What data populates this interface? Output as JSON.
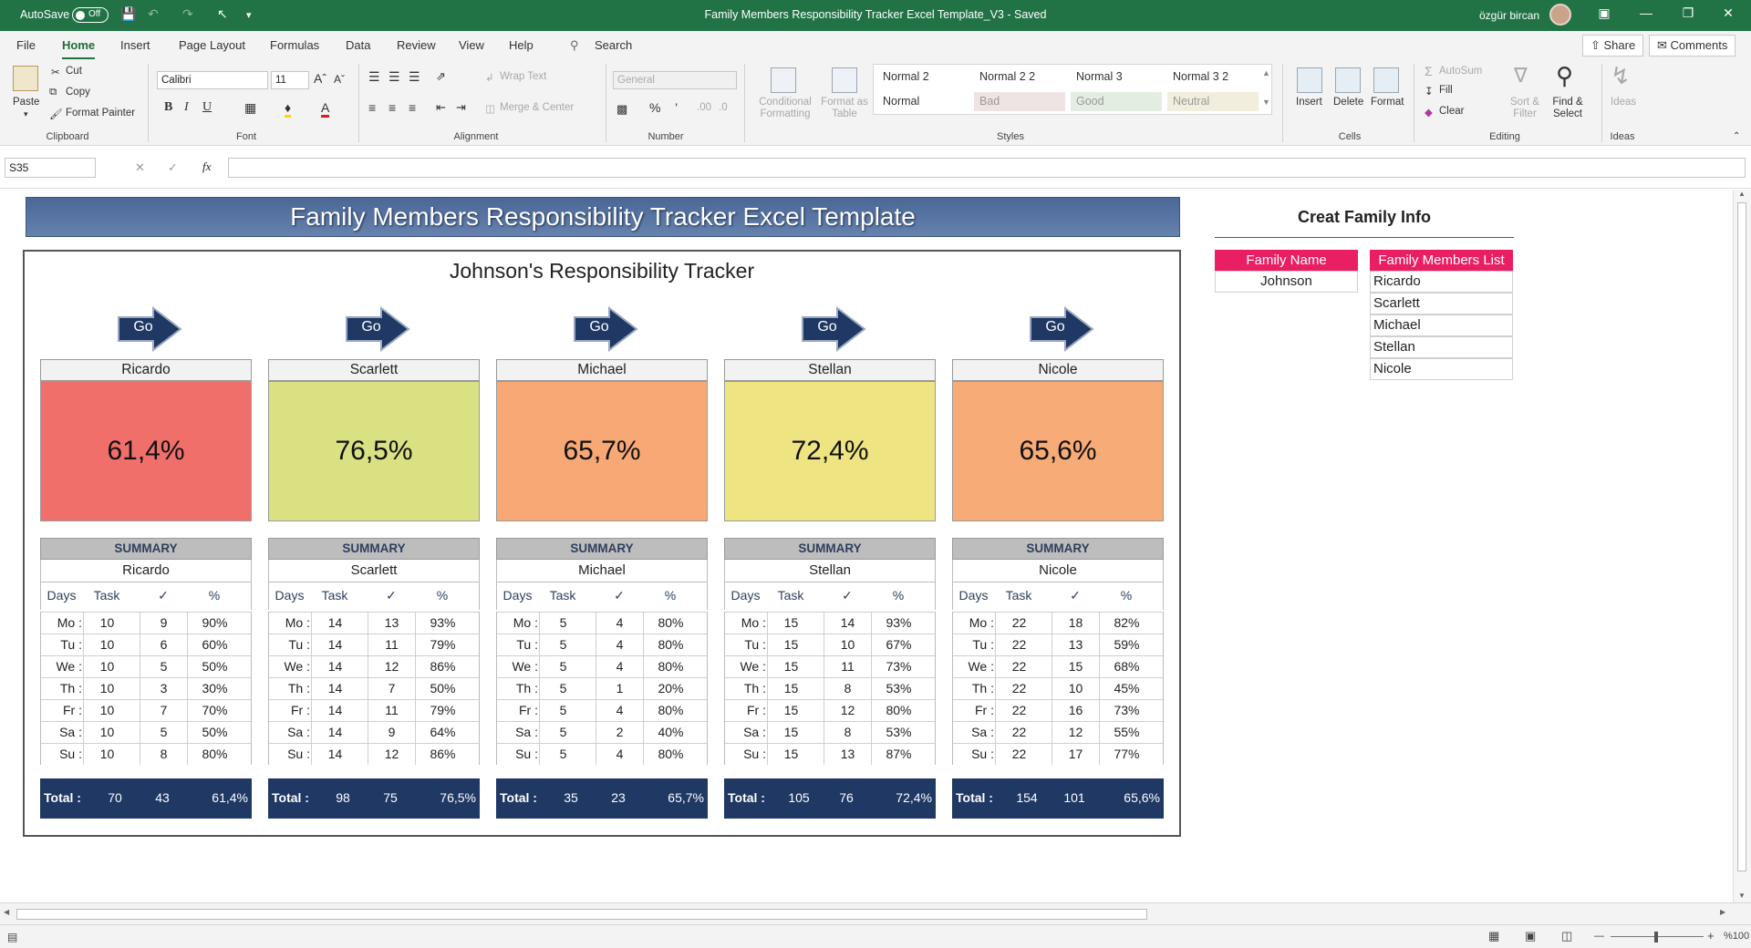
{
  "titlebar": {
    "autosave_label": "AutoSave",
    "autosave_state": "Off",
    "title": "Family Members Responsibility Tracker Excel Template_V3  -  Saved",
    "user": "özgür bircan"
  },
  "menu": {
    "tabs": [
      "File",
      "Home",
      "Insert",
      "Page Layout",
      "Formulas",
      "Data",
      "Review",
      "View",
      "Help"
    ],
    "active": "Home",
    "search": "Search",
    "share": "Share",
    "comments": "Comments"
  },
  "ribbon": {
    "clipboard": {
      "paste": "Paste",
      "cut": "Cut",
      "copy": "Copy",
      "format_painter": "Format Painter",
      "label": "Clipboard"
    },
    "font": {
      "name": "Calibri",
      "size": "11",
      "label": "Font"
    },
    "alignment": {
      "wrap": "Wrap Text",
      "merge": "Merge & Center",
      "label": "Alignment"
    },
    "number": {
      "format": "General",
      "label": "Number"
    },
    "styles": {
      "conditional": "Conditional Formatting",
      "format_table": "Format as Table",
      "cells": [
        "Normal 2",
        "Normal 2 2",
        "Normal 3",
        "Normal 3 2",
        "Normal",
        "Bad",
        "Good",
        "Neutral"
      ],
      "label": "Styles"
    },
    "cells": {
      "insert": "Insert",
      "delete": "Delete",
      "format": "Format",
      "label": "Cells"
    },
    "editing": {
      "autosum": "AutoSum",
      "fill": "Fill",
      "clear": "Clear",
      "sort": "Sort & Filter",
      "find": "Find & Select",
      "label": "Editing"
    },
    "ideas": {
      "ideas": "Ideas",
      "label": "Ideas"
    }
  },
  "formula_bar": {
    "name_box": "S35",
    "fx": "fx",
    "value": ""
  },
  "sheet": {
    "banner": "Family Members Responsibility Tracker Excel Template",
    "tracker_title": "Johnson's Responsibility Tracker",
    "go_label": "Go",
    "summary_label": "SUMMARY",
    "col_headers": [
      "Days",
      "Task",
      "✓",
      "%"
    ],
    "total_label": "Total :",
    "members": [
      {
        "name": "Ricardo",
        "pct": "61,4%",
        "color": "#f16f6b",
        "rows": [
          [
            "Mo :",
            "10",
            "9",
            "90%"
          ],
          [
            "Tu :",
            "10",
            "6",
            "60%"
          ],
          [
            "We :",
            "10",
            "5",
            "50%"
          ],
          [
            "Th :",
            "10",
            "3",
            "30%"
          ],
          [
            "Fr :",
            "10",
            "7",
            "70%"
          ],
          [
            "Sa :",
            "10",
            "5",
            "50%"
          ],
          [
            "Su :",
            "10",
            "8",
            "80%"
          ]
        ],
        "total": [
          "70",
          "43",
          "61,4%"
        ]
      },
      {
        "name": "Scarlett",
        "pct": "76,5%",
        "color": "#d9e183",
        "rows": [
          [
            "Mo :",
            "14",
            "13",
            "93%"
          ],
          [
            "Tu :",
            "14",
            "11",
            "79%"
          ],
          [
            "We :",
            "14",
            "12",
            "86%"
          ],
          [
            "Th :",
            "14",
            "7",
            "50%"
          ],
          [
            "Fr :",
            "14",
            "11",
            "79%"
          ],
          [
            "Sa :",
            "14",
            "9",
            "64%"
          ],
          [
            "Su :",
            "14",
            "12",
            "86%"
          ]
        ],
        "total": [
          "98",
          "75",
          "76,5%"
        ]
      },
      {
        "name": "Michael",
        "pct": "65,7%",
        "color": "#f7a874",
        "rows": [
          [
            "Mo :",
            "5",
            "4",
            "80%"
          ],
          [
            "Tu :",
            "5",
            "4",
            "80%"
          ],
          [
            "We :",
            "5",
            "4",
            "80%"
          ],
          [
            "Th :",
            "5",
            "1",
            "20%"
          ],
          [
            "Fr :",
            "5",
            "4",
            "80%"
          ],
          [
            "Sa :",
            "5",
            "2",
            "40%"
          ],
          [
            "Su :",
            "5",
            "4",
            "80%"
          ]
        ],
        "total": [
          "35",
          "23",
          "65,7%"
        ]
      },
      {
        "name": "Stellan",
        "pct": "72,4%",
        "color": "#eee482",
        "rows": [
          [
            "Mo :",
            "15",
            "14",
            "93%"
          ],
          [
            "Tu :",
            "15",
            "10",
            "67%"
          ],
          [
            "We :",
            "15",
            "11",
            "73%"
          ],
          [
            "Th :",
            "15",
            "8",
            "53%"
          ],
          [
            "Fr :",
            "15",
            "12",
            "80%"
          ],
          [
            "Sa :",
            "15",
            "8",
            "53%"
          ],
          [
            "Su :",
            "15",
            "13",
            "87%"
          ]
        ],
        "total": [
          "105",
          "76",
          "72,4%"
        ]
      },
      {
        "name": "Nicole",
        "pct": "65,6%",
        "color": "#f7ab76",
        "rows": [
          [
            "Mo :",
            "22",
            "18",
            "82%"
          ],
          [
            "Tu :",
            "22",
            "13",
            "59%"
          ],
          [
            "We :",
            "22",
            "15",
            "68%"
          ],
          [
            "Th :",
            "22",
            "10",
            "45%"
          ],
          [
            "Fr :",
            "22",
            "16",
            "73%"
          ],
          [
            "Sa :",
            "22",
            "12",
            "55%"
          ],
          [
            "Su :",
            "22",
            "17",
            "77%"
          ]
        ],
        "total": [
          "154",
          "101",
          "65,6%"
        ]
      }
    ],
    "info": {
      "title": "Creat Family Info",
      "family_name_header": "Family Name",
      "family_name": "Johnson",
      "members_header": "Family Members List",
      "members_list": [
        "Ricardo",
        "Scarlett",
        "Michael",
        "Stellan",
        "Nicole"
      ]
    }
  },
  "status": {
    "zoom": "%100"
  },
  "colors": {
    "brand": "#217346",
    "navy": "#1f3864",
    "pink": "#e91e63"
  }
}
